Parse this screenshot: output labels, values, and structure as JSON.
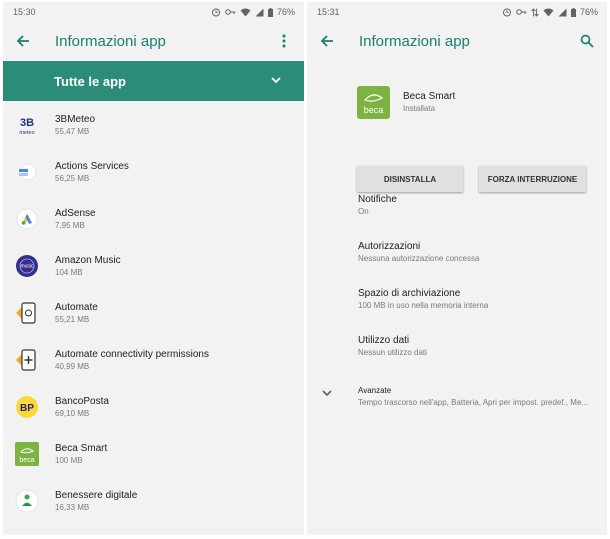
{
  "left": {
    "status": {
      "time": "15:30",
      "battery": "76%"
    },
    "toolbar": {
      "title": "Informazioni app"
    },
    "filter": {
      "label": "Tutte le app"
    },
    "apps": [
      {
        "name": "3BMeteo",
        "size": "55,47 MB",
        "icon": "3bmeteo-icon"
      },
      {
        "name": "Actions Services",
        "size": "56,25 MB",
        "icon": "actions-services-icon"
      },
      {
        "name": "AdSense",
        "size": "7,95 MB",
        "icon": "adsense-icon"
      },
      {
        "name": "Amazon Music",
        "size": "104 MB",
        "icon": "amazon-music-icon"
      },
      {
        "name": "Automate",
        "size": "55,21 MB",
        "icon": "automate-icon"
      },
      {
        "name": "Automate connectivity permissions",
        "size": "40,99 MB",
        "icon": "automate-connectivity-icon"
      },
      {
        "name": "BancoPosta",
        "size": "69,10 MB",
        "icon": "bancoposta-icon"
      },
      {
        "name": "Beca Smart",
        "size": "100 MB",
        "icon": "beca-smart-icon"
      },
      {
        "name": "Benessere digitale",
        "size": "16,33 MB",
        "icon": "benessere-digitale-icon"
      }
    ]
  },
  "right": {
    "status": {
      "time": "15:31",
      "battery": "76%"
    },
    "toolbar": {
      "title": "Informazioni app"
    },
    "app": {
      "name": "Beca Smart",
      "state": "Installata",
      "icon_text": "beca"
    },
    "buttons": {
      "uninstall": "DISINSTALLA",
      "force_stop": "FORZA INTERRUZIONE"
    },
    "prefs": {
      "notifications": {
        "title": "Notifiche",
        "summary": "On"
      },
      "permissions": {
        "title": "Autorizzazioni",
        "summary": "Nessuna autorizzazione concessa"
      },
      "storage": {
        "title": "Spazio di archiviazione",
        "summary": "100 MB in uso nella memoria interna"
      },
      "data": {
        "title": "Utilizzo dati",
        "summary": "Nessun utilizzo dati"
      },
      "advanced": {
        "title": "Avanzate",
        "summary": "Tempo trascorso nell'app, Batteria, Apri per impost. predef., Me..."
      }
    }
  },
  "colors": {
    "accent": "#1a7f6e",
    "filter_bar": "#2a8c79",
    "background": "#f2f2f2"
  }
}
